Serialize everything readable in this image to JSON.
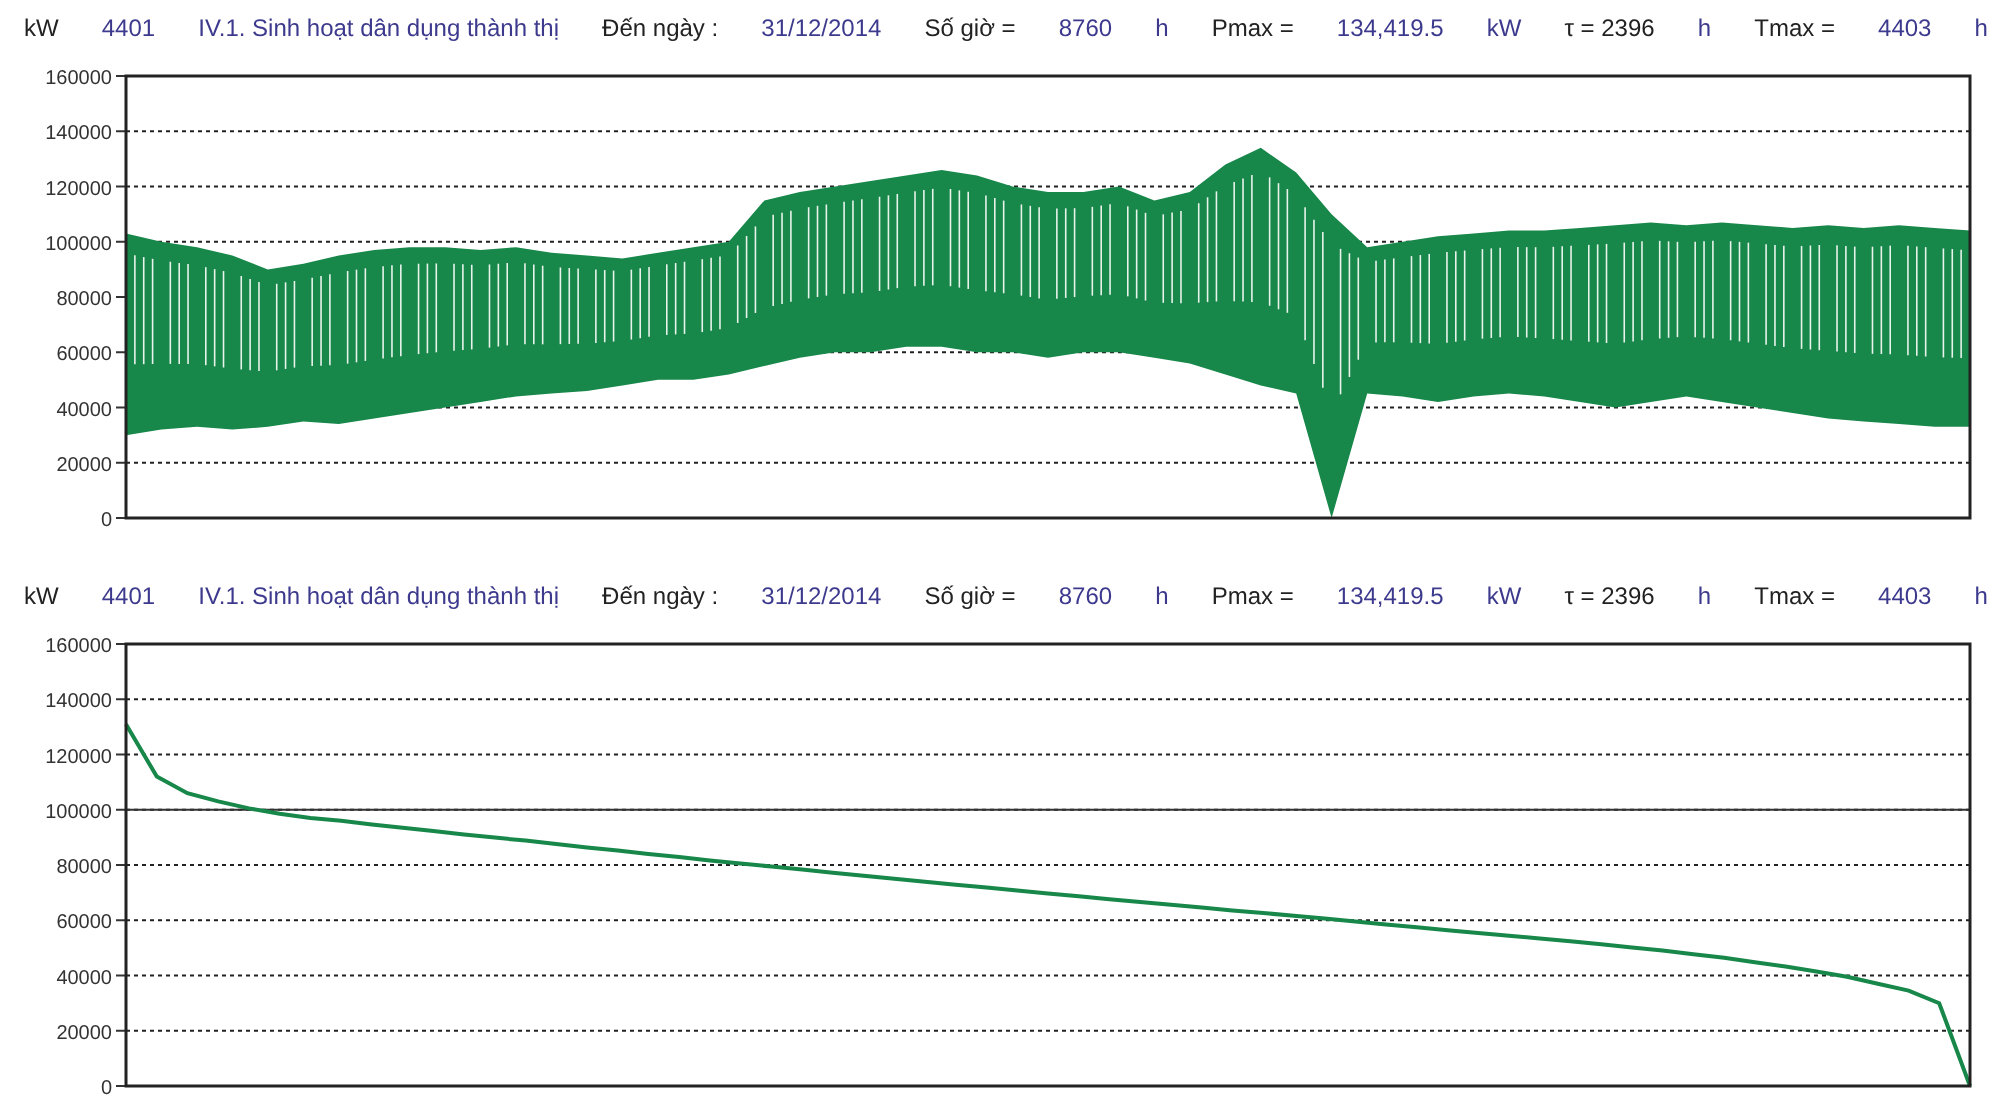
{
  "panels": [
    {
      "header": [
        {
          "kind": "label",
          "text": "kW"
        },
        {
          "kind": "value",
          "text": "4401"
        },
        {
          "kind": "value",
          "text": "IV.1. Sinh hoạt dân dụng thành thị"
        },
        {
          "kind": "label",
          "text": "Đến ngày :"
        },
        {
          "kind": "value",
          "text": "31/12/2014"
        },
        {
          "kind": "label",
          "text": "Số giờ ="
        },
        {
          "kind": "value",
          "text": "8760"
        },
        {
          "kind": "value",
          "text": "h"
        },
        {
          "kind": "label",
          "text": "Pmax ="
        },
        {
          "kind": "value",
          "text": "134,419.5"
        },
        {
          "kind": "value",
          "text": "kW"
        },
        {
          "kind": "label",
          "text": "τ = 2396"
        },
        {
          "kind": "value",
          "text": "h"
        },
        {
          "kind": "label",
          "text": "Tmax ="
        },
        {
          "kind": "value",
          "text": "4403"
        },
        {
          "kind": "value",
          "text": "h"
        }
      ],
      "waveform": {
        "y_axis_labels": [
          "160000",
          "140000",
          "120000",
          "100000",
          "80000",
          "60000",
          "40000",
          "20000",
          "0"
        ]
      }
    },
    {
      "header": [
        {
          "kind": "label",
          "text": "kW"
        },
        {
          "kind": "value",
          "text": "4401"
        },
        {
          "kind": "value",
          "text": "IV.1. Sinh hoạt dân dụng thành thị"
        },
        {
          "kind": "label",
          "text": "Đến ngày :"
        },
        {
          "kind": "value",
          "text": "31/12/2014"
        },
        {
          "kind": "label",
          "text": "Số giờ ="
        },
        {
          "kind": "value",
          "text": "8760"
        },
        {
          "kind": "value",
          "text": "h"
        },
        {
          "kind": "label",
          "text": "Pmax ="
        },
        {
          "kind": "value",
          "text": "134,419.5"
        },
        {
          "kind": "value",
          "text": "kW"
        },
        {
          "kind": "label",
          "text": "τ = 2396"
        },
        {
          "kind": "value",
          "text": "h"
        },
        {
          "kind": "label",
          "text": "Tmax ="
        },
        {
          "kind": "value",
          "text": "4403"
        },
        {
          "kind": "value",
          "text": "h"
        }
      ],
      "chart_data": {
        "type": "line",
        "grid": true,
        "ylim": [
          0,
          160000
        ],
        "yticks": [
          0,
          20000,
          40000,
          60000,
          80000,
          100000,
          120000,
          140000,
          160000
        ],
        "ref_lines": [
          {
            "axis": "y",
            "value": 100000
          }
        ],
        "categories": [
          null,
          null,
          null,
          null,
          null,
          null,
          null,
          null,
          null,
          null,
          null,
          null,
          null,
          null,
          null,
          null,
          null,
          null,
          null,
          null,
          null,
          null,
          null,
          null,
          null,
          null,
          null,
          null,
          null,
          null,
          null,
          null,
          null,
          null,
          null,
          null,
          null,
          null,
          null,
          null,
          null,
          null,
          null,
          null,
          null,
          null,
          null,
          null,
          null,
          null,
          null,
          null,
          null,
          null,
          null,
          null,
          null,
          null,
          null,
          null,
          null
        ],
        "series": [
          {
            "color": "#17874a",
            "values": [
              131000,
              112000,
              106000,
              103000,
              100500,
              98500,
              97000,
              96000,
              94700,
              93500,
              92300,
              91100,
              89900,
              88800,
              87600,
              86400,
              85200,
              84000,
              82900,
              81700,
              80600,
              79400,
              78300,
              77200,
              76100,
              75000,
              73900,
              72800,
              71800,
              70800,
              69700,
              68700,
              67600,
              66600,
              65600,
              64600,
              63600,
              62600,
              61600,
              60600,
              59500,
              58500,
              57500,
              56400,
              55400,
              54400,
              53400,
              52400,
              51300,
              50200,
              49000,
              47700,
              46400,
              44800,
              43200,
              41500,
              39500,
              37000,
              34500,
              30000,
              0
            ]
          }
        ]
      }
    }
  ]
}
